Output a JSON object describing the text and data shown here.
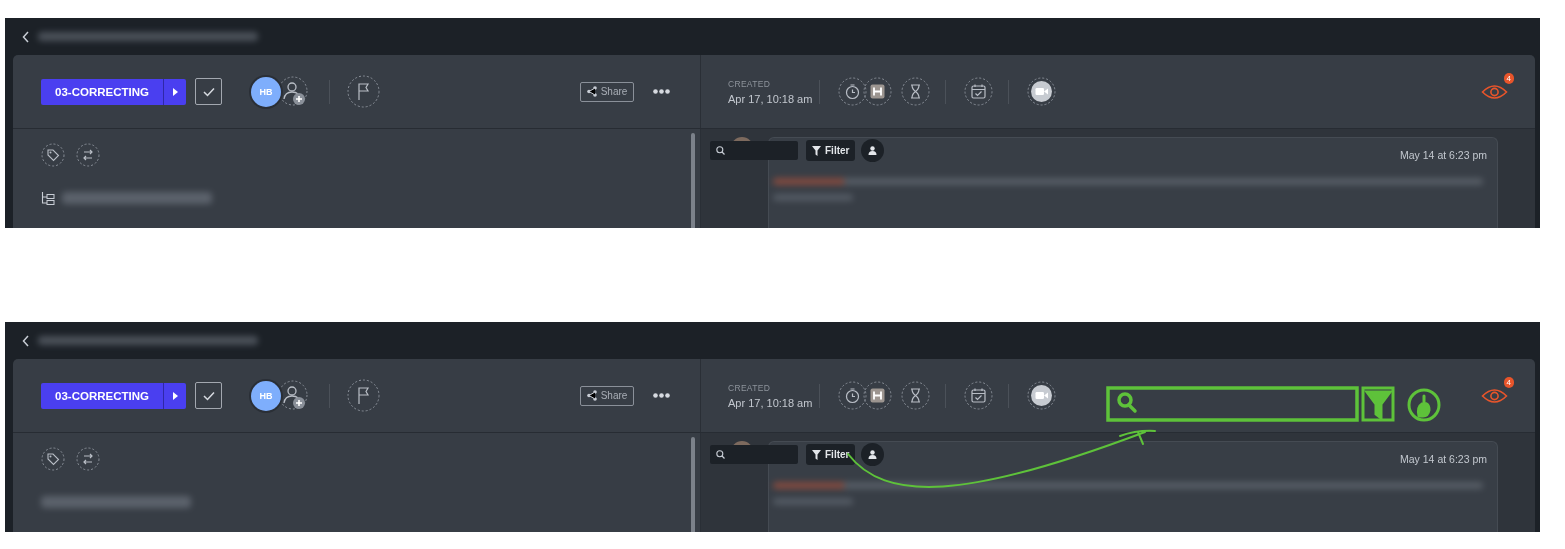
{
  "panels": [
    {
      "status": "03-CORRECTING",
      "checked": true,
      "avatar": "HB",
      "share": "Share",
      "created_label": "CREATED",
      "created_date": "Apr 17, 10:18 am",
      "watchers": "4",
      "filter": "Filter",
      "comment_time": "May 14 at 6:23 pm",
      "tree_icon": true,
      "annotation": false
    },
    {
      "status": "03-CORRECTING",
      "checked": true,
      "avatar": "HB",
      "share": "Share",
      "created_label": "CREATED",
      "created_date": "Apr 17, 10:18 am",
      "watchers": "4",
      "filter": "Filter",
      "comment_time": "May 14 at 6:23 pm",
      "tree_icon": false,
      "annotation": true
    }
  ]
}
